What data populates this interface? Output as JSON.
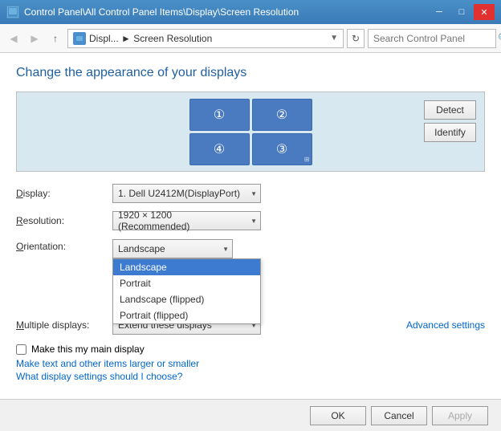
{
  "titlebar": {
    "title": "Control Panel\\All Control Panel Items\\Display\\Screen Resolution",
    "min_label": "─",
    "max_label": "□",
    "close_label": "✕"
  },
  "addressbar": {
    "back_icon": "◀",
    "forward_icon": "▶",
    "up_icon": "↑",
    "path_label": "Displ... ▶ Screen Resolution",
    "dropdown_arrow": "▼",
    "refresh_icon": "↻",
    "search_placeholder": "Search Control Panel",
    "search_icon": "🔍"
  },
  "page": {
    "title": "Change the appearance of your displays",
    "detect_button": "Detect",
    "identify_button": "Identify",
    "displays": [
      {
        "number": "①",
        "id": 1
      },
      {
        "number": "②",
        "id": 2
      },
      {
        "number": "④",
        "id": 4
      },
      {
        "number": "③",
        "id": 3
      }
    ],
    "form": {
      "display_label": "Display:",
      "display_value": "1. Dell U2412M(DisplayPort)",
      "resolution_label": "Resolution:",
      "resolution_value": "1920 × 1200 (Recommended)",
      "orientation_label": "Orientation:",
      "orientation_value": "Landscape",
      "multiple_label": "Multiple displays:",
      "multiple_value": "Extend these displays",
      "checkbox_label": "Make this my main display",
      "advanced_link": "Advanced settings"
    },
    "orientation_options": [
      {
        "value": "Landscape",
        "selected": true
      },
      {
        "value": "Portrait",
        "selected": false
      },
      {
        "value": "Landscape (flipped)",
        "selected": false
      },
      {
        "value": "Portrait (flipped)",
        "selected": false
      }
    ],
    "links": [
      "Make text and other items larger or smaller",
      "What display settings should I choose?"
    ]
  },
  "footer": {
    "ok_label": "OK",
    "cancel_label": "Cancel",
    "apply_label": "Apply"
  }
}
